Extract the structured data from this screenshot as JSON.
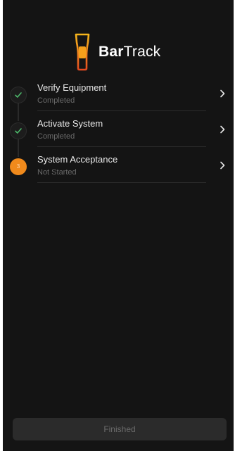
{
  "brand": {
    "name_bold": "Bar",
    "name_light": "Track",
    "logo_icon": "beer-glass-icon",
    "accent_colors": [
      "#f5b51b",
      "#e2491f"
    ]
  },
  "steps": [
    {
      "index": "1",
      "title": "Verify Equipment",
      "status": "Completed",
      "state": "done",
      "icon": "checkmark-icon"
    },
    {
      "index": "2",
      "title": "Activate System",
      "status": "Completed",
      "state": "done",
      "icon": "checkmark-icon"
    },
    {
      "index": "3",
      "title": "System Acceptance",
      "status": "Not Started",
      "state": "current",
      "icon": ""
    }
  ],
  "colors": {
    "background": "#141414",
    "check": "#4db86a",
    "current_step": "#f08a1c"
  },
  "footer": {
    "finished_label": "Finished"
  }
}
